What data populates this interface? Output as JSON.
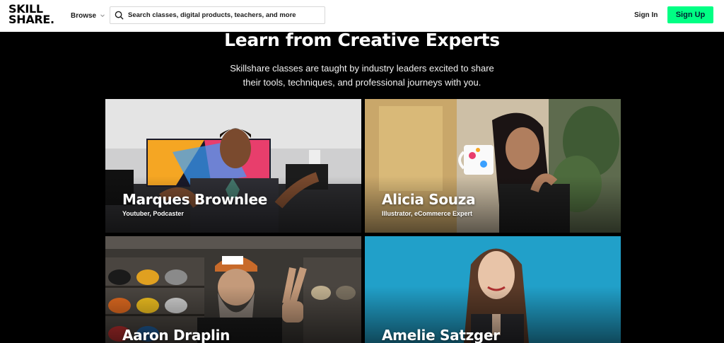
{
  "header": {
    "logo_line1": "SKILL",
    "logo_line2": "SHARE.",
    "browse_label": "Browse",
    "search_placeholder": "Search classes, digital products, teachers, and more",
    "signin_label": "Sign In",
    "signup_label": "Sign Up"
  },
  "hero": {
    "title": "Learn from Creative Experts",
    "subtitle": "Skillshare classes are taught by industry leaders excited to share their tools, techniques, and professional journeys with you."
  },
  "experts": [
    {
      "name": "Marques Brownlee",
      "role": "Youtuber, Podcaster"
    },
    {
      "name": "Alicia Souza",
      "role": "Illustrator, eCommerce Expert"
    },
    {
      "name": "Aaron Draplin",
      "role": ""
    },
    {
      "name": "Amelie Satzger",
      "role": ""
    }
  ],
  "colors": {
    "accent": "#00ff84",
    "background": "#000000",
    "header_bg": "#ffffff"
  },
  "icons": {
    "search": "search-icon",
    "browse_caret": "chevron-down-icon"
  }
}
